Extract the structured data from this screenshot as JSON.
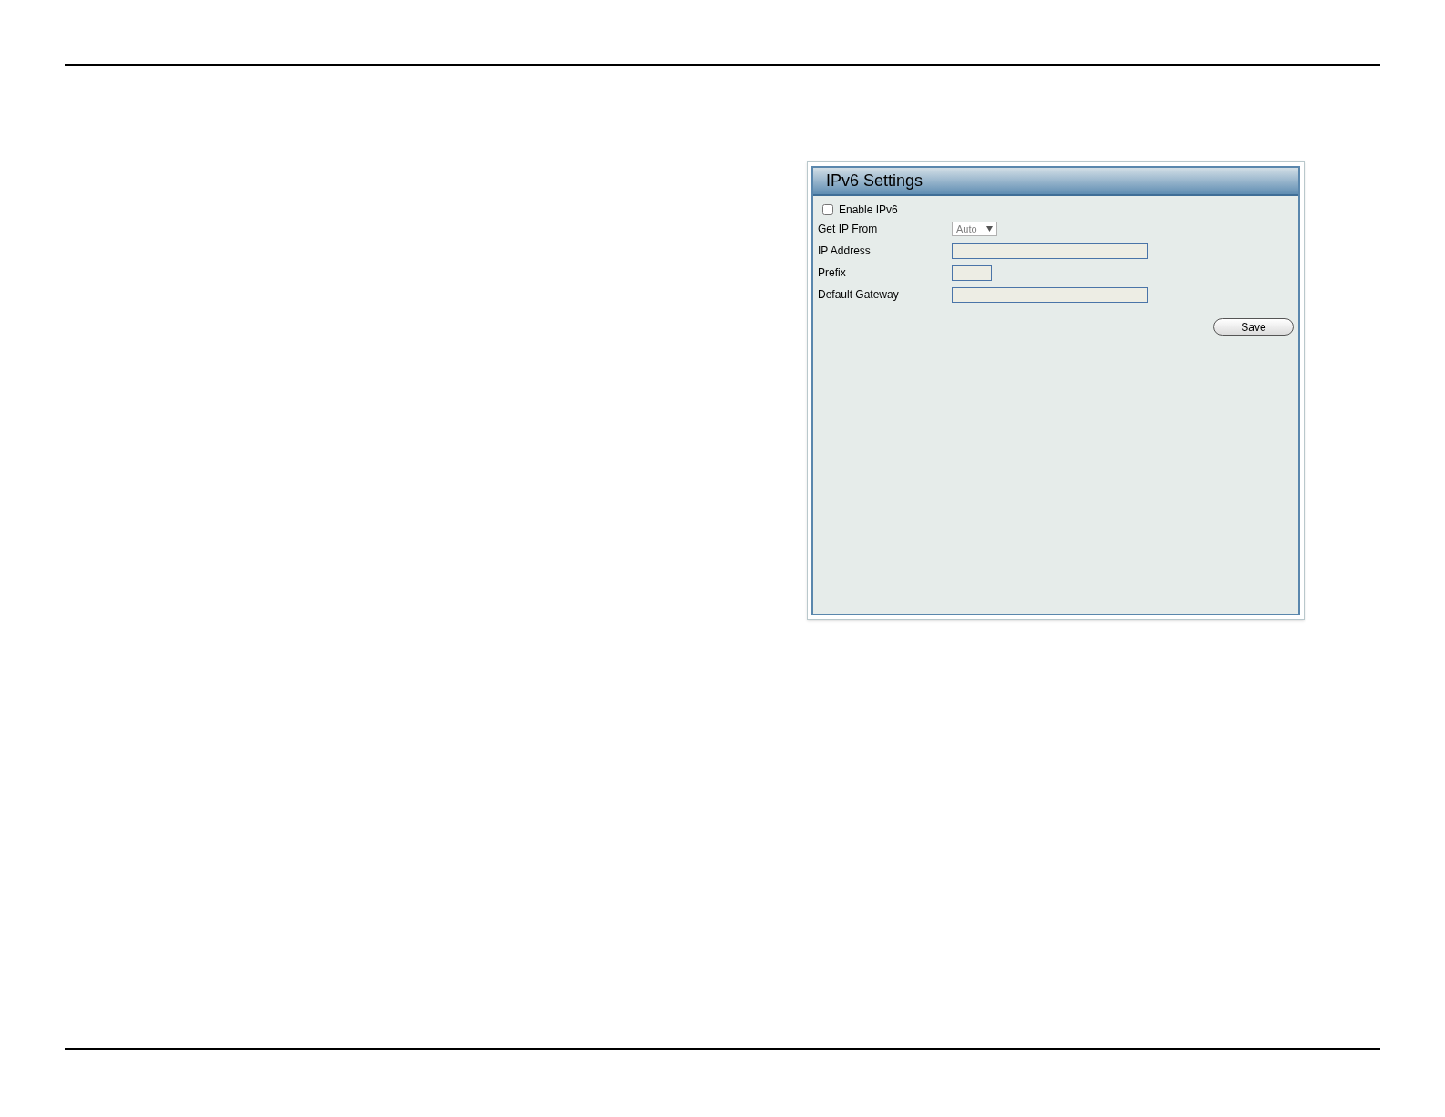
{
  "panel": {
    "title": "IPv6 Settings",
    "enable": {
      "label": "Enable IPv6",
      "checked": false
    },
    "fields": [
      {
        "kind": "select",
        "label": "Get IP From",
        "value": "Auto",
        "disabled": true
      },
      {
        "kind": "text",
        "label": "IP Address"
      },
      {
        "kind": "short_text",
        "label": "Prefix"
      },
      {
        "kind": "text",
        "label": "Default Gateway"
      }
    ],
    "save": "Save"
  }
}
